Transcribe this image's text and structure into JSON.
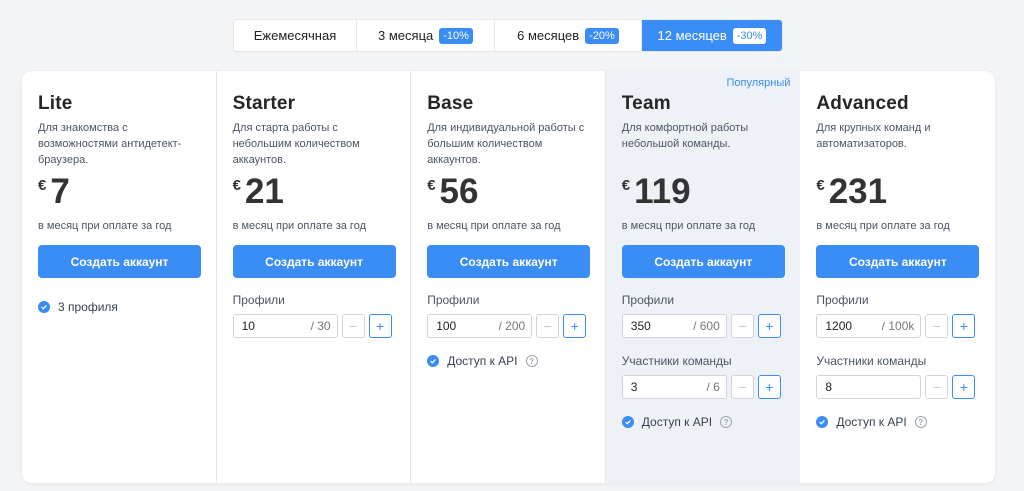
{
  "billing_tabs": [
    {
      "label": "Ежемесячная",
      "badge": ""
    },
    {
      "label": "3 месяца",
      "badge": "-10%"
    },
    {
      "label": "6 месяцев",
      "badge": "-20%"
    },
    {
      "label": "12 месяцев",
      "badge": "-30%"
    }
  ],
  "active_tab": "12 месяцев",
  "common": {
    "currency": "€",
    "period_text": "в месяц при оплате за год",
    "cta_label": "Создать аккаунт",
    "profiles_label": "Профили",
    "team_members_label": "Участники команды",
    "api_label": "Доступ к API",
    "popular_label": "Популярный",
    "help_glyph": "?",
    "minus_glyph": "−",
    "plus_glyph": "+"
  },
  "plans": {
    "lite": {
      "name": "Lite",
      "description": "Для знакомства с возможностями антидетект-браузера.",
      "price": "7",
      "profiles_feature": "3 профиля"
    },
    "starter": {
      "name": "Starter",
      "description": "Для старта работы с небольшим количеством аккаунтов.",
      "price": "21",
      "profiles_value": "10",
      "profiles_max": "/ 30"
    },
    "base": {
      "name": "Base",
      "description": "Для индивидуальной работы с большим количеством аккаунтов.",
      "price": "56",
      "profiles_value": "100",
      "profiles_max": "/ 200"
    },
    "team": {
      "name": "Team",
      "description": "Для комфортной работы небольшой команды.",
      "price": "119",
      "profiles_value": "350",
      "profiles_max": "/ 600",
      "members_value": "3",
      "members_max": "/ 6"
    },
    "advanced": {
      "name": "Advanced",
      "description": "Для крупных команд и автоматизаторов.",
      "price": "231",
      "profiles_value": "1200",
      "profiles_max": "/ 100k",
      "members_value": "8",
      "members_max": ""
    }
  },
  "colors": {
    "accent": "#3b8df6",
    "featured_bg": "#eef2f7",
    "page_bg": "#f3f4f6"
  },
  "icons": {
    "check": "check-circle-icon",
    "help": "question-circle-icon"
  }
}
